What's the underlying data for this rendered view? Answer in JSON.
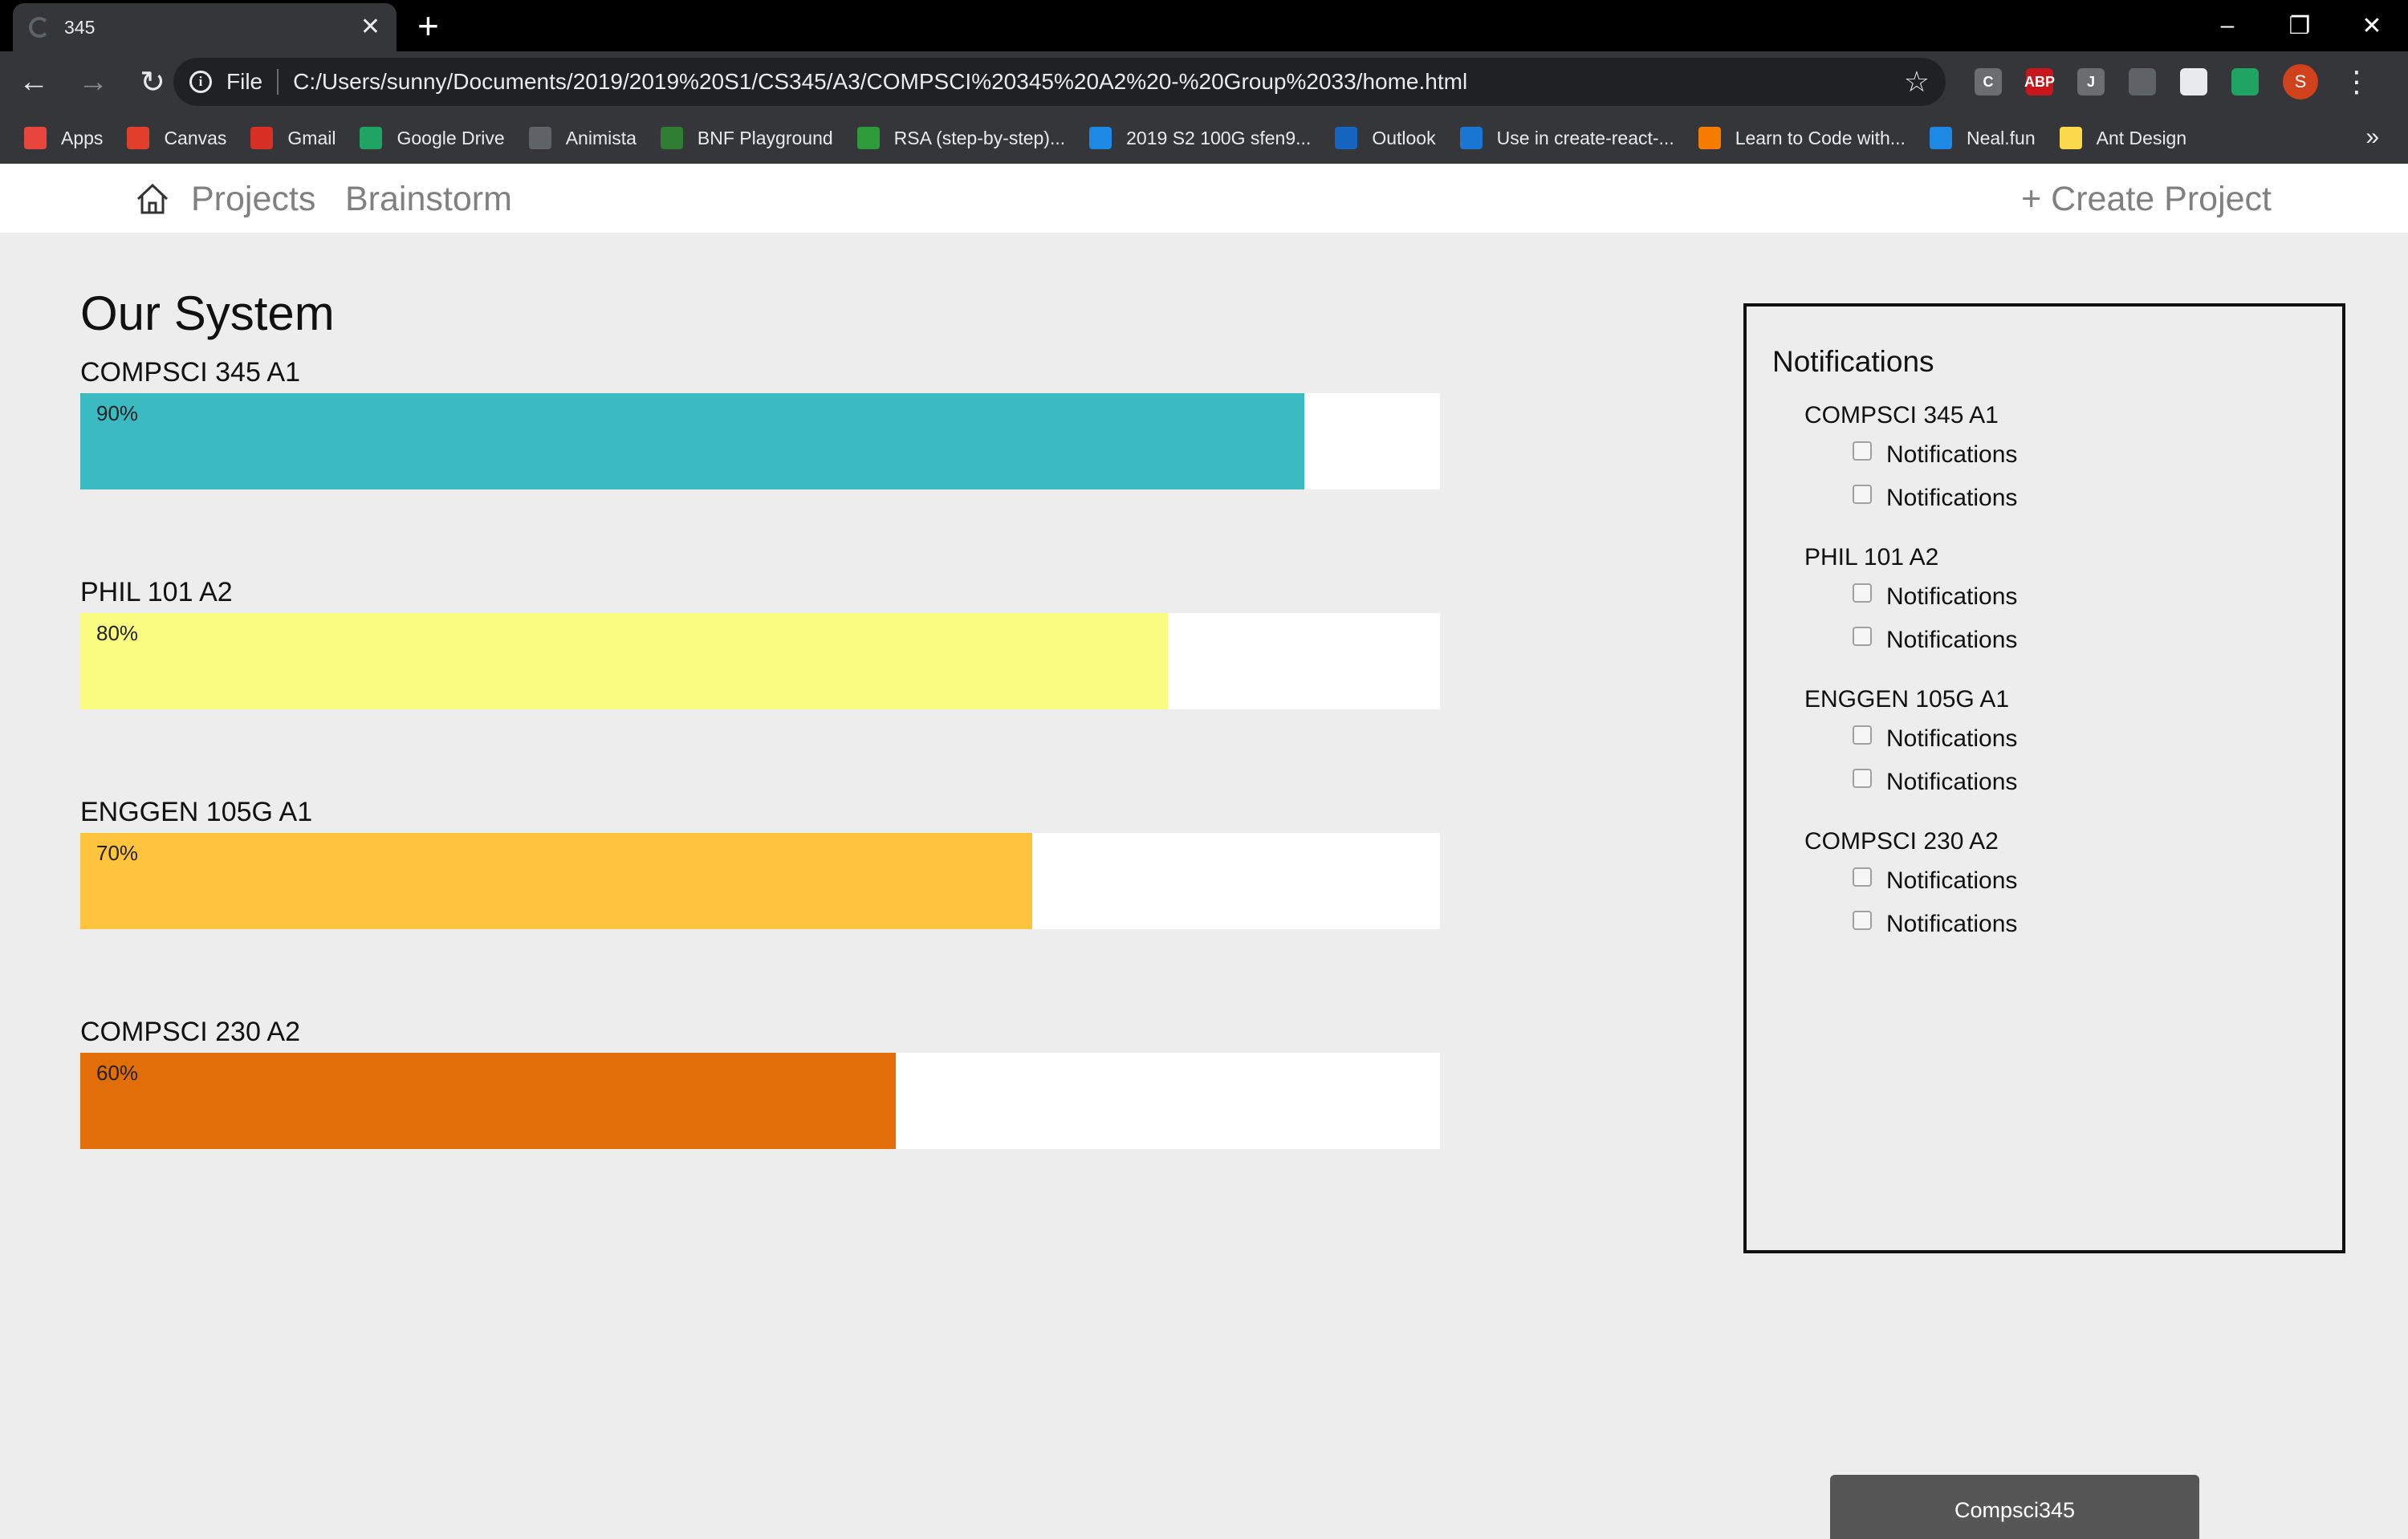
{
  "browser": {
    "tab_title": "345",
    "new_tab": "+",
    "scheme": "File",
    "url": "C:/Users/sunny/Documents/2019/2019%20S1/CS345/A3/COMPSCI%20345%20A2%20-%20Group%2033/home.html",
    "avatar_letter": "S",
    "extensions": [
      {
        "label": "C",
        "color": "#6b6d70"
      },
      {
        "label": "ABP",
        "color": "#c9161c"
      },
      {
        "label": "J",
        "color": "#6b6d70"
      },
      {
        "label": "",
        "color": "#5f6368"
      },
      {
        "label": "",
        "color": "#e8eaed"
      },
      {
        "label": "",
        "color": "#1fa463"
      }
    ],
    "bookmarks": [
      {
        "label": "Apps",
        "icon": "apps-grid-icon",
        "color": "#e8453c"
      },
      {
        "label": "Canvas",
        "icon": "canvas-icon",
        "color": "#e13f2b"
      },
      {
        "label": "Gmail",
        "icon": "gmail-icon",
        "color": "#d93025"
      },
      {
        "label": "Google Drive",
        "icon": "google-drive-icon",
        "color": "#1fa463"
      },
      {
        "label": "Animista",
        "icon": "animista-icon",
        "color": "#5f6368"
      },
      {
        "label": "BNF Playground",
        "icon": "bnf-icon",
        "color": "#2e7d32"
      },
      {
        "label": "RSA (step-by-step)...",
        "icon": "rsa-icon",
        "color": "#2e9b3a"
      },
      {
        "label": "2019 S2 100G sfen9...",
        "icon": "trello-icon",
        "color": "#1e88e5"
      },
      {
        "label": "Outlook",
        "icon": "outlook-icon",
        "color": "#1565c0"
      },
      {
        "label": "Use in create-react-...",
        "icon": "react-icon",
        "color": "#1976d2"
      },
      {
        "label": "Learn to Code with...",
        "icon": "code-icon",
        "color": "#f57c00"
      },
      {
        "label": "Neal.fun",
        "icon": "globe-icon",
        "color": "#1e88e5"
      },
      {
        "label": "Ant Design",
        "icon": "folder-icon",
        "color": "#f9d849"
      }
    ],
    "more_bookmarks": "»"
  },
  "navbar": {
    "links": [
      "Projects",
      "Brainstorm"
    ],
    "create_label": "Create Project"
  },
  "main": {
    "title": "Our System",
    "projects": [
      {
        "name": "COMPSCI 345 A1",
        "progress": 0.9,
        "label": "90%",
        "color": "#3bbac2"
      },
      {
        "name": "PHIL 101 A2",
        "progress": 0.8,
        "label": "80%",
        "color": "#f9fc80"
      },
      {
        "name": "ENGGEN 105G A1",
        "progress": 0.7,
        "label": "70%",
        "color": "#fec43d"
      },
      {
        "name": "COMPSCI 230 A2",
        "progress": 0.6,
        "label": "60%",
        "color": "#e26e09"
      }
    ]
  },
  "notifications": {
    "title": "Notifications",
    "groups": [
      {
        "name": "COMPSCI 345 A1",
        "items": [
          "Notifications",
          "Notifications"
        ]
      },
      {
        "name": "PHIL 101 A2",
        "items": [
          "Notifications",
          "Notifications"
        ]
      },
      {
        "name": "ENGGEN 105G A1",
        "items": [
          "Notifications",
          "Notifications"
        ]
      },
      {
        "name": "COMPSCI 230 A2",
        "items": [
          "Notifications",
          "Notifications"
        ]
      }
    ]
  },
  "footer": {
    "label": "Compsci345"
  }
}
